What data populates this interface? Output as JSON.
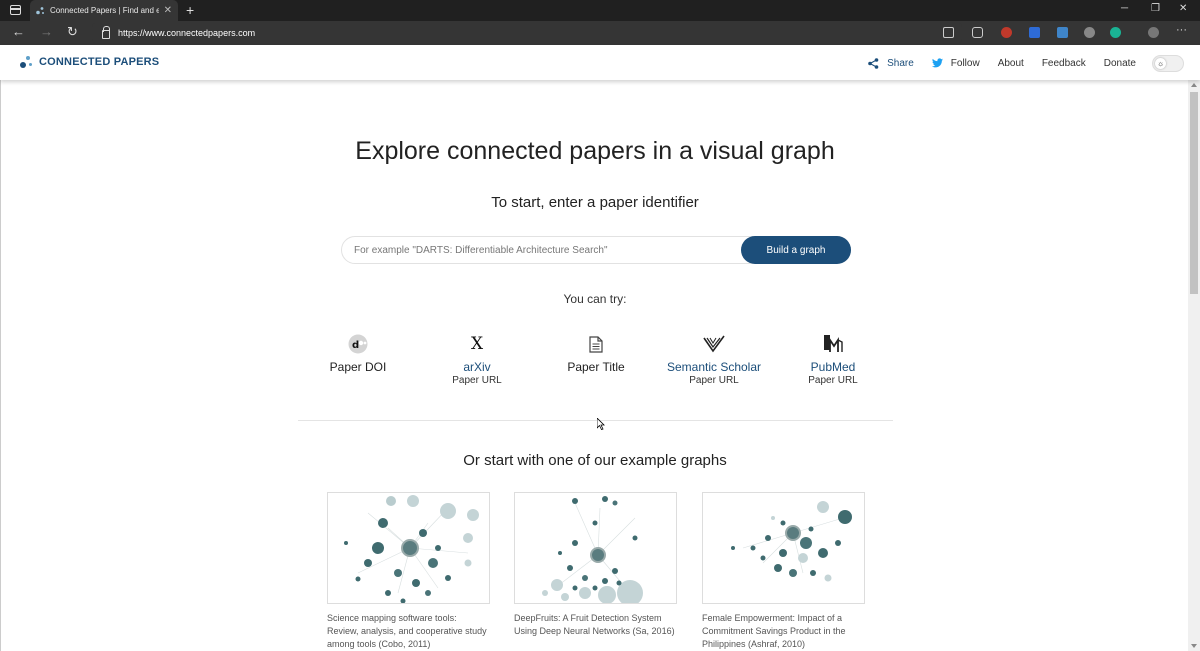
{
  "browser": {
    "tab_title": "Connected Papers | Find and exp",
    "url": "https://www.connectedpapers.com"
  },
  "header": {
    "logo_text": "CONNECTED PAPERS",
    "nav": {
      "share": "Share",
      "follow": "Follow",
      "about": "About",
      "feedback": "Feedback",
      "donate": "Donate"
    }
  },
  "main": {
    "title": "Explore connected papers in a visual graph",
    "subtitle": "To start, enter a paper identifier",
    "search_placeholder": "For example \"DARTS: Differentiable Architecture Search\"",
    "build_button": "Build a graph",
    "try_label": "You can try:",
    "options": [
      {
        "title": "Paper DOI",
        "sub": "",
        "icon": "doi-icon"
      },
      {
        "title": "arXiv",
        "sub": "Paper URL",
        "icon": "arxiv-icon"
      },
      {
        "title": "Paper Title",
        "sub": "",
        "icon": "document-icon"
      },
      {
        "title": "Semantic Scholar",
        "sub": "Paper URL",
        "icon": "semantic-scholar-icon"
      },
      {
        "title": "PubMed",
        "sub": "Paper URL",
        "icon": "pubmed-icon"
      }
    ],
    "examples_title": "Or start with one of our example graphs",
    "examples": [
      {
        "caption": "Science mapping software tools: Review, analysis, and cooperative study among tools (Cobo, 2011)"
      },
      {
        "caption": "DeepFruits: A Fruit Detection System Using Deep Neural Networks (Sa, 2016)"
      },
      {
        "caption": "Female Empowerment: Impact of a Commitment Savings Product in the Philippines (Ashraf, 2010)"
      }
    ]
  },
  "colors": {
    "brand": "#1c4e7a",
    "node_dark": "#3f6b6f",
    "node_light": "#b9ccce"
  }
}
